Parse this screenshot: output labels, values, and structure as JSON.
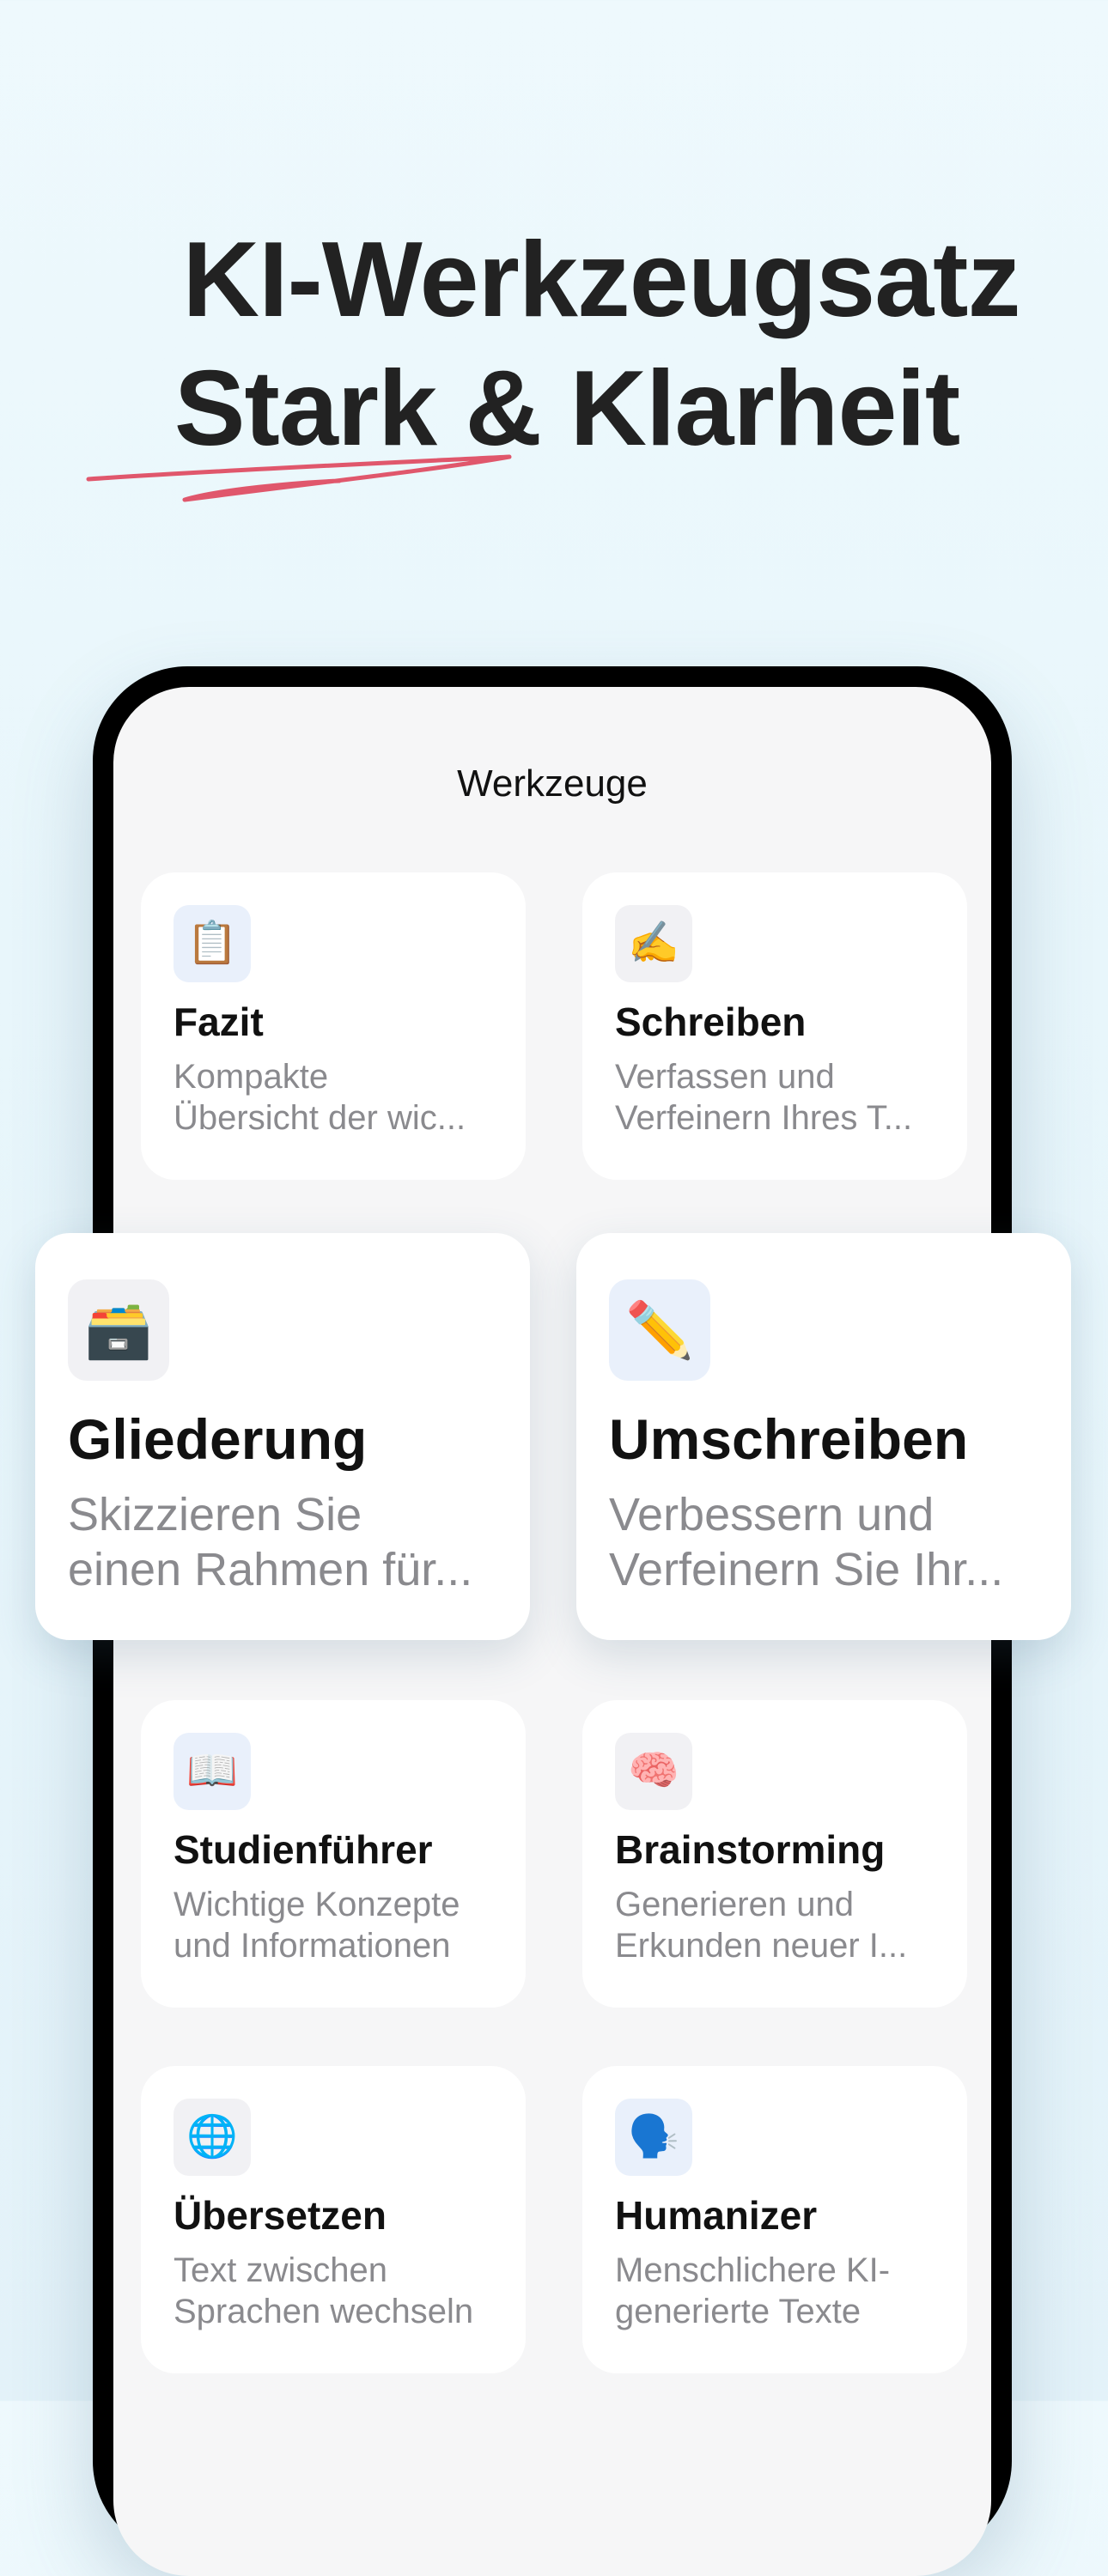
{
  "headline": {
    "line1": "KI-Werkzeugsatz",
    "line2": "Stark & Klarheit"
  },
  "colors": {
    "background": "#eef9fd",
    "underline": "#e0576c",
    "card": "#ffffff",
    "title": "#111111",
    "description": "#8a8a8e"
  },
  "screen": {
    "title": "Werkzeuge"
  },
  "tools": [
    {
      "icon": "clipboard-icon",
      "glyph": "📋",
      "title": "Fazit",
      "desc1": "Kompakte",
      "desc2": "Übersicht der wic..."
    },
    {
      "icon": "writing-hand-icon",
      "glyph": "✍️",
      "title": "Schreiben",
      "desc1": "Verfassen und",
      "desc2": "Verfeinern Ihres T..."
    },
    {
      "icon": "card-file-box-icon",
      "glyph": "🗃️",
      "title": "Gliederung",
      "desc1": "Skizzieren Sie",
      "desc2": "einen Rahmen für..."
    },
    {
      "icon": "pencil-icon",
      "glyph": "✏️",
      "title": "Umschreiben",
      "desc1": "Verbessern und",
      "desc2": "Verfeinern Sie Ihr..."
    },
    {
      "icon": "open-book-icon",
      "glyph": "📖",
      "title": "Studienführer",
      "desc1": "Wichtige Konzepte",
      "desc2": "und Informationen"
    },
    {
      "icon": "brain-icon",
      "glyph": "🧠",
      "title": "Brainstorming",
      "desc1": "Generieren und",
      "desc2": "Erkunden neuer I..."
    },
    {
      "icon": "globe-icon",
      "glyph": "🌐",
      "title": "Übersetzen",
      "desc1": "Text zwischen",
      "desc2": "Sprachen wechseln"
    },
    {
      "icon": "speaking-head-icon",
      "glyph": "🗣️",
      "title": "Humanizer",
      "desc1": "Menschlichere KI-",
      "desc2": "generierte Texte"
    }
  ]
}
